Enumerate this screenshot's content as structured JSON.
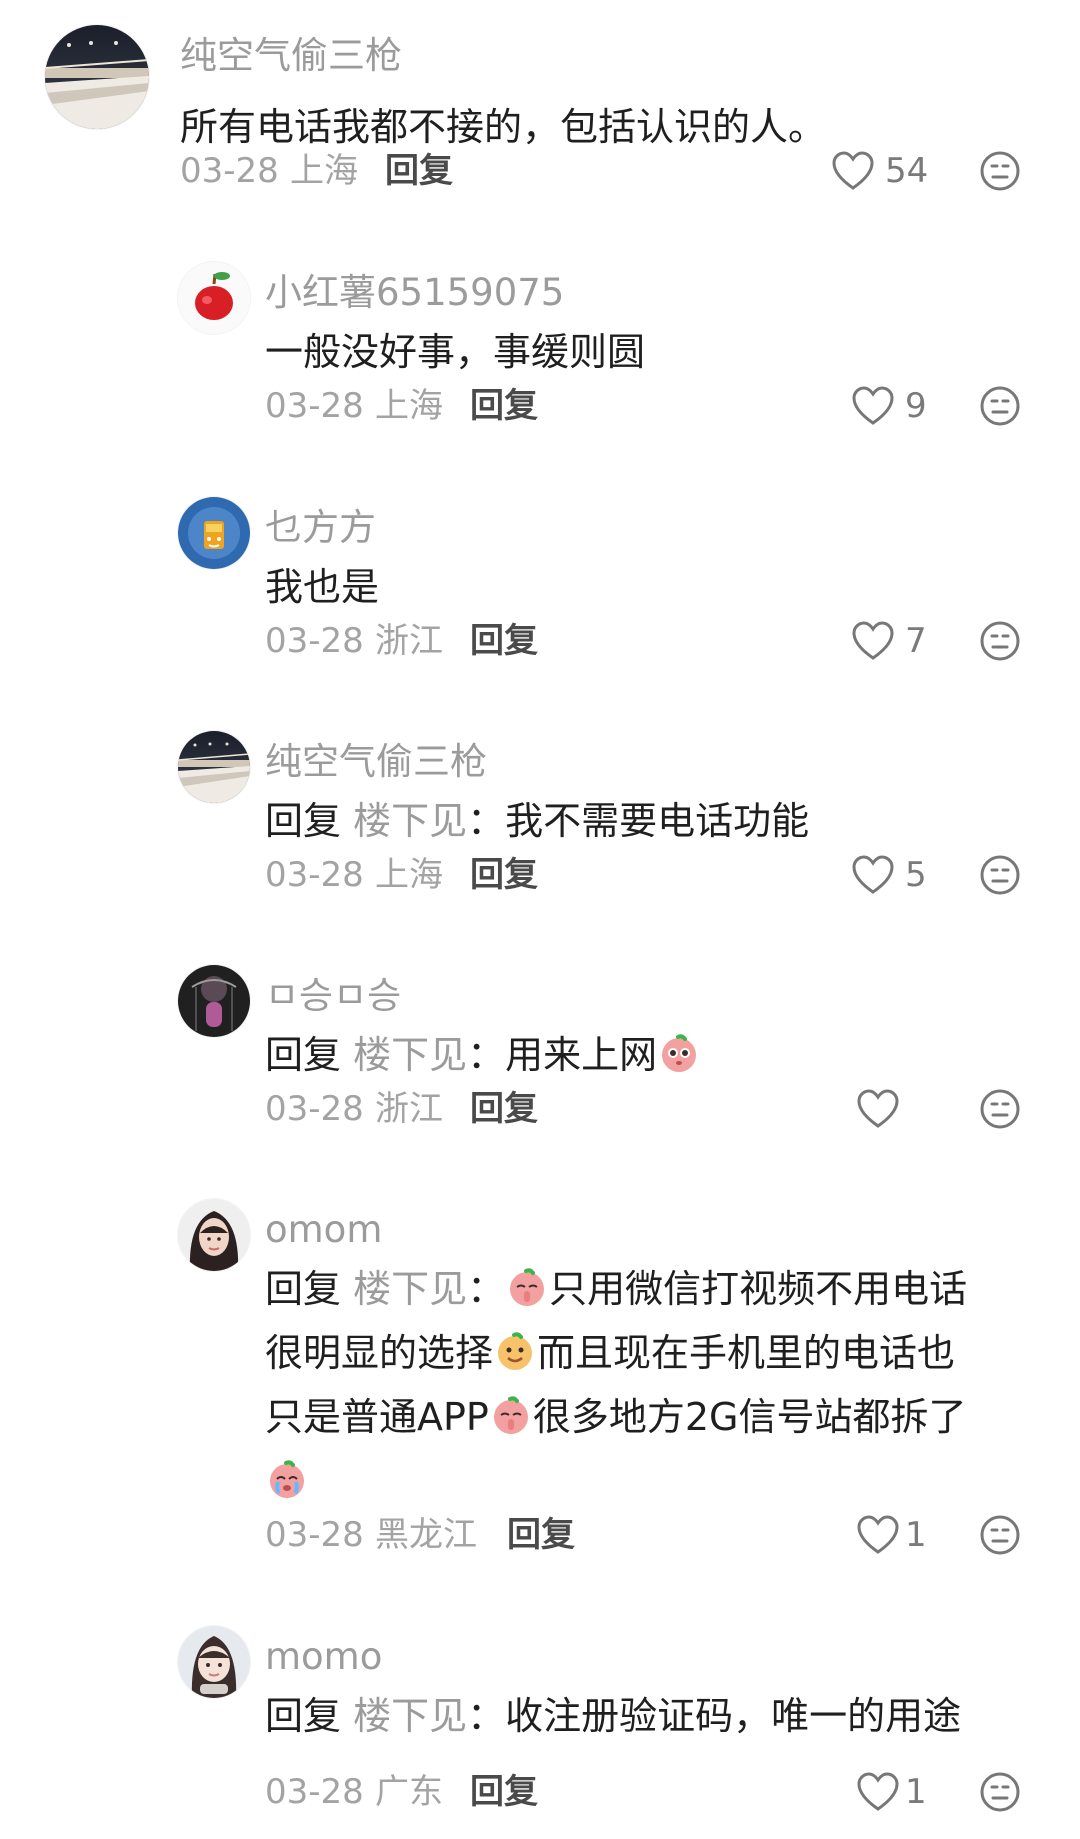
{
  "comments": [
    {
      "username": "纯空气偷三枪",
      "text": "所有电话我都不接的，包括认识的人。",
      "date": "03-28",
      "location": "上海",
      "reply_label": "回复",
      "likes": "54",
      "avatar_icon": "station-avatar"
    },
    {
      "username": "小红薯65159075",
      "text": "一般没好事，事缓则圆",
      "date": "03-28",
      "location": "上海",
      "reply_label": "回复",
      "likes": "9",
      "avatar_icon": "apple-avatar"
    },
    {
      "username": "乜方方",
      "text": "我也是",
      "date": "03-28",
      "location": "浙江",
      "reply_label": "回复",
      "likes": "7",
      "avatar_icon": "cartoon-avatar"
    },
    {
      "username": "纯空气偷三枪",
      "reply_prefix": "回复",
      "reply_target": "楼下见",
      "separator": "：",
      "text": "我不需要电话功能",
      "date": "03-28",
      "location": "上海",
      "reply_label": "回复",
      "likes": "5",
      "avatar_icon": "station-avatar"
    },
    {
      "username": "ㅁ승ㅁ승",
      "reply_prefix": "回复",
      "reply_target": "楼下见",
      "separator": "：",
      "text": "用来上网",
      "date": "03-28",
      "location": "浙江",
      "reply_label": "回复",
      "likes": "",
      "avatar_icon": "dark-photo-avatar"
    },
    {
      "username": "omom",
      "reply_prefix": "回复",
      "reply_target": "楼下见",
      "separator": "：",
      "text_line_1": "只用微信打视频不用电话",
      "text_line_2a": "很明显的选择",
      "text_line_2b": "而且现在手机里的电话也",
      "text_line_3a": "只是普通APP",
      "text_line_3b": "很多地方2G信号站都拆了",
      "date": "03-28",
      "location": "黑龙江",
      "reply_label": "回复",
      "likes": "1",
      "avatar_icon": "girl-photo-avatar"
    },
    {
      "username": "momo",
      "reply_prefix": "回复",
      "reply_target": "楼下见",
      "separator": "：",
      "text": "收注册验证码，唯一的用途",
      "date": "03-28",
      "location": "广东",
      "reply_label": "回复",
      "likes": "1",
      "avatar_icon": "child-photo-avatar"
    }
  ],
  "colors": {
    "username": "#9b9b9b",
    "text": "#1f1f1f",
    "meta": "#a3a3a3",
    "reply_action": "#4a4a4a",
    "icon": "#777777"
  }
}
